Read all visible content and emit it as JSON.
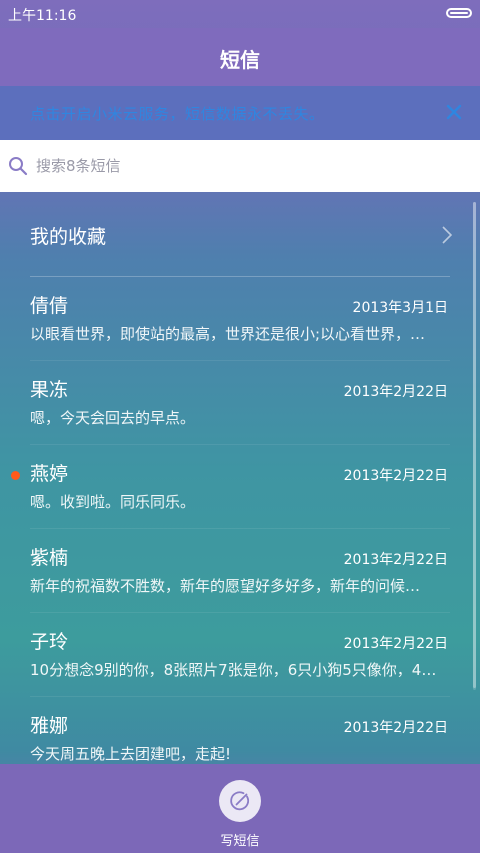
{
  "status_bar": {
    "time": "上午11:16"
  },
  "header": {
    "title": "短信"
  },
  "cloud_banner": {
    "text": "点击开启小米云服务，短信数据永不丢失。"
  },
  "search": {
    "placeholder": "搜索8条短信"
  },
  "favorites": {
    "label": "我的收藏"
  },
  "conversations": [
    {
      "name": "倩倩",
      "date": "2013年3月1日",
      "preview": "以眼看世界，即使站的最高，世界还是很小;以心看世界，…",
      "unread": false
    },
    {
      "name": "果冻",
      "date": "2013年2月22日",
      "preview": "嗯，今天会回去的早点。",
      "unread": false
    },
    {
      "name": "燕婷",
      "date": "2013年2月22日",
      "preview": "嗯。收到啦。同乐同乐。",
      "unread": true
    },
    {
      "name": "紫楠",
      "date": "2013年2月22日",
      "preview": "新年的祝福数不胜数，新年的愿望好多好多，新年的问候…",
      "unread": false
    },
    {
      "name": "子玲",
      "date": "2013年2月22日",
      "preview": "10分想念9别的你，8张照片7张是你，6只小狗5只像你，4…",
      "unread": false
    },
    {
      "name": "雅娜",
      "date": "2013年2月22日",
      "preview": "今天周五晚上去团建吧，走起!",
      "unread": false
    }
  ],
  "bottom_bar": {
    "compose_label": "写短信"
  },
  "colors": {
    "unread_dot": "#ff5a1a",
    "banner_text": "#2f86e0",
    "header_bg": "#7f6bbd"
  }
}
